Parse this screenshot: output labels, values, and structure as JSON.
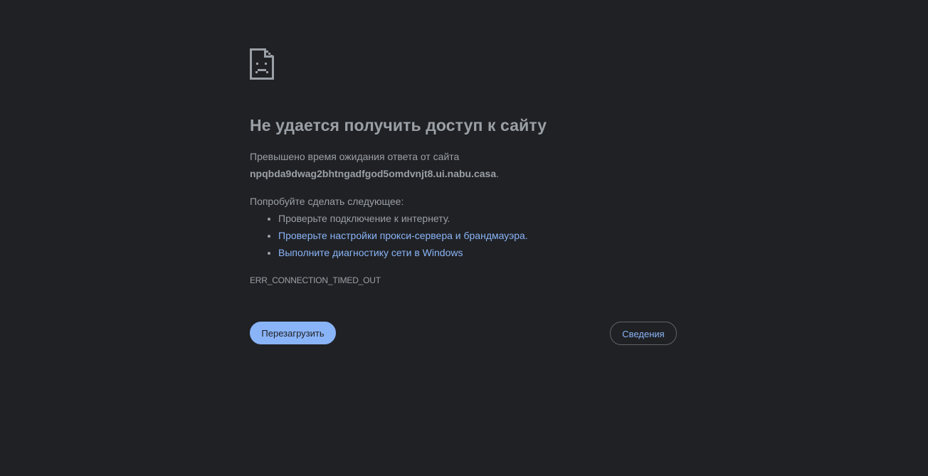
{
  "main": {
    "title": "Не удается получить доступ к сайту",
    "description_prefix": "Превышено время ожидания ответа от сайта",
    "host": "npqbda9dwag2bhtngadfgod5omdvnjt8.ui.nabu.casa",
    "host_suffix": ".",
    "suggestions_heading": "Попробуйте сделать следующее:",
    "suggestions": [
      {
        "label": "Проверьте подключение к интернету.",
        "is_link": false
      },
      {
        "label": "Проверьте настройки прокси-сервера и брандмауэра",
        "suffix": ".",
        "is_link": true
      },
      {
        "label": "Выполните диагностику сети в Windows",
        "suffix": "",
        "is_link": true
      }
    ],
    "error_code": "ERR_CONNECTION_TIMED_OUT"
  },
  "buttons": {
    "reload_label": "Перезагрузить",
    "details_label": "Сведения"
  },
  "icons": {
    "error_icon": "sad-page-icon"
  },
  "colors": {
    "background": "#202124",
    "text": "#9aa0a6",
    "link": "#8ab4f8",
    "button_primary": "#8ab4f8"
  }
}
